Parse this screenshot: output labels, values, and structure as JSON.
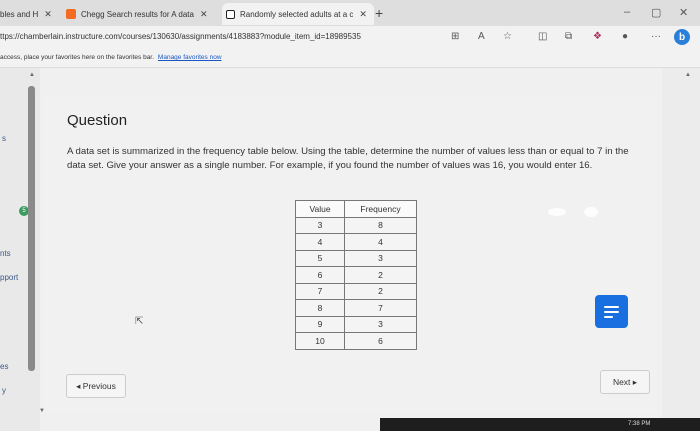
{
  "tabs": [
    {
      "label": "bles and H",
      "active": false
    },
    {
      "label": "Chegg Search results for A data",
      "active": false
    },
    {
      "label": "Randomly selected adults at a c",
      "active": true
    }
  ],
  "new_tab_symbol": "+",
  "address": {
    "url": "ttps://chamberlain.instructure.com/courses/130630/assignments/4183883?module_item_id=18989535"
  },
  "favorites_bar": {
    "text": "access, place your favorites here on the favorites bar.",
    "link": "Manage favorites now"
  },
  "left_nav": {
    "items": [
      "s",
      "nts",
      "pport",
      "es",
      "y"
    ],
    "badge": "5"
  },
  "question": {
    "title": "Question",
    "text_parts": [
      "A data set is summarized in the frequency table below. Using the table, determine the number of values less than or equal to ",
      "7",
      " in the data set. Give your answer as a single number. For example, if you found the number of values was ",
      "16",
      ", you would enter ",
      "16",
      "."
    ]
  },
  "table": {
    "headers": [
      "Value",
      "Frequency"
    ],
    "rows": [
      [
        "3",
        "8"
      ],
      [
        "4",
        "4"
      ],
      [
        "5",
        "3"
      ],
      [
        "6",
        "2"
      ],
      [
        "7",
        "2"
      ],
      [
        "8",
        "7"
      ],
      [
        "9",
        "3"
      ],
      [
        "10",
        "6"
      ]
    ]
  },
  "buttons": {
    "previous": "◂ Previous",
    "next": "Next ▸"
  },
  "clock": "7:38 PM",
  "colors": {
    "chat_button": "#1a6fe0",
    "badge": "#3c9c5f",
    "link": "#1a57c4"
  },
  "icons": [
    "close-icon",
    "chegg-icon",
    "tab-page-icon",
    "read-aloud-icon",
    "favorite-star-icon",
    "split-screen-icon",
    "collections-icon",
    "profile-icon",
    "more-icon",
    "bing-icon",
    "chat-icon"
  ]
}
